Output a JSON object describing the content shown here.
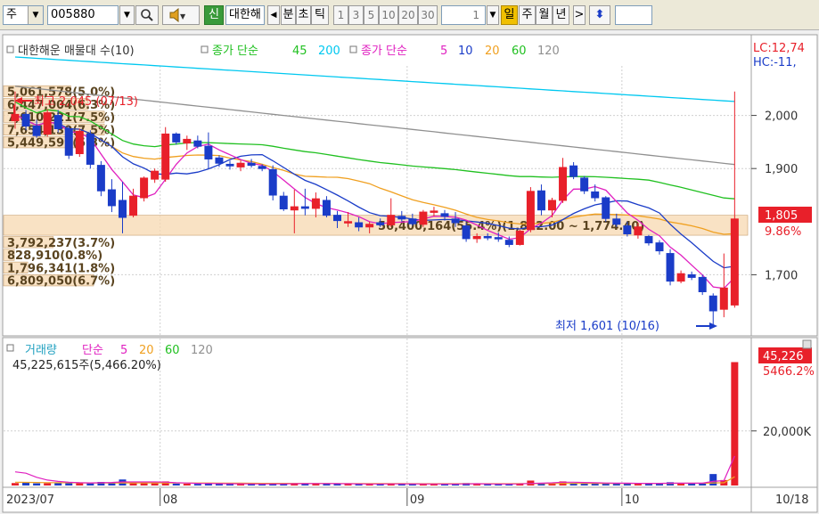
{
  "toolbar": {
    "market": "주",
    "code": "005880",
    "badge": "신",
    "name": "대한해",
    "periods": [
      "분",
      "초",
      "틱"
    ],
    "ticks": [
      "1",
      "3",
      "5",
      "10",
      "20",
      "30"
    ],
    "tick_input": "1",
    "day": "일",
    "week": "주",
    "month": "월",
    "year": "년"
  },
  "chart_data": {
    "type": "candlestick",
    "legend": {
      "vp": "대한해운 매물대 수(10)",
      "ma1_label": "종가 단순",
      "ma1_periods": [
        "45",
        "200"
      ],
      "ma2_label": "종가 단순",
      "ma2_periods": [
        "5",
        "10",
        "20",
        "60",
        "120"
      ]
    },
    "vol_legend": {
      "name": "거래량",
      "ma_label": "단순",
      "ma_periods": [
        "5",
        "20",
        "60",
        "120"
      ],
      "info": "45,225,615주(5,466.20%)"
    },
    "colors": {
      "up": "#e8202a",
      "down": "#1a3cc8",
      "ma5": "#e020c0",
      "ma10": "#1a3cc8",
      "ma20": "#f0a020",
      "ma60": "#20c020",
      "ma120": "#909090",
      "ma45": "#20c020",
      "ma200": "#00c8f0"
    },
    "corner": {
      "lc": "LC:12,74",
      "hc": "HC:-11,"
    },
    "price_ticks": [
      "2,000",
      "1,900",
      "1,700"
    ],
    "price_tick_values": [
      2000,
      1900,
      1700
    ],
    "price_range": [
      1590,
      2110
    ],
    "last_price": "1,805",
    "last_pct": "9.86%",
    "max_label": "최고 2,045 (07/13)",
    "min_label": "최저 1,601 (10/16)",
    "volume_profile": [
      {
        "label": "5,061,578(5.0%)",
        "price_low": 2035,
        "price_high": 2056
      },
      {
        "label": "6,447,004(6.3%)",
        "price_low": 2011,
        "price_high": 2032
      },
      {
        "label": "7,610,221(7.5%)",
        "price_low": 1987,
        "price_high": 2008
      },
      {
        "label": "7,654,130(7.5%)",
        "price_low": 1963,
        "price_high": 1984
      },
      {
        "label": "5,449,599(5.3%)",
        "price_low": 1939,
        "price_high": 1960
      },
      {
        "label": "56,400,164(55.4%)(1,812.00 ~ 1,774.40)",
        "price_low": 1774.4,
        "price_high": 1812
      },
      {
        "label": "3,792,237(3.7%)",
        "price_low": 1751,
        "price_high": 1772
      },
      {
        "label": "828,910(0.8%)",
        "price_low": 1727,
        "price_high": 1748
      },
      {
        "label": "1,796,341(1.8%)",
        "price_low": 1703,
        "price_high": 1724
      },
      {
        "label": "6,809,050(6.7%)",
        "price_low": 1679,
        "price_high": 1700
      }
    ],
    "volume_ticks": [
      "20,000K"
    ],
    "volume_tick_values": [
      20000
    ],
    "volume_range": [
      0,
      48000
    ],
    "volume_last": "45,226",
    "volume_last_pct": "5466.2%",
    "x_labels": [
      {
        "label": "2023/07",
        "index": 0
      },
      {
        "label": "08",
        "index": 14
      },
      {
        "label": "09",
        "index": 37
      },
      {
        "label": "10",
        "index": 57
      }
    ],
    "date_label": "10/18",
    "candles": [
      {
        "o": 1990,
        "h": 2045,
        "l": 1975,
        "c": 2002
      },
      {
        "o": 2002,
        "h": 2010,
        "l": 1972,
        "c": 1980
      },
      {
        "o": 1980,
        "h": 1992,
        "l": 1958,
        "c": 1962
      },
      {
        "o": 1965,
        "h": 2012,
        "l": 1960,
        "c": 2005
      },
      {
        "o": 2000,
        "h": 2010,
        "l": 1968,
        "c": 1975
      },
      {
        "o": 1975,
        "h": 1980,
        "l": 1918,
        "c": 1925
      },
      {
        "o": 1928,
        "h": 1975,
        "l": 1922,
        "c": 1970
      },
      {
        "o": 1965,
        "h": 1972,
        "l": 1900,
        "c": 1908
      },
      {
        "o": 1906,
        "h": 1914,
        "l": 1848,
        "c": 1858
      },
      {
        "o": 1860,
        "h": 1880,
        "l": 1818,
        "c": 1830
      },
      {
        "o": 1840,
        "h": 1875,
        "l": 1778,
        "c": 1808
      },
      {
        "o": 1812,
        "h": 1862,
        "l": 1808,
        "c": 1848
      },
      {
        "o": 1845,
        "h": 1885,
        "l": 1838,
        "c": 1882
      },
      {
        "o": 1880,
        "h": 1900,
        "l": 1873,
        "c": 1895
      },
      {
        "o": 1880,
        "h": 1978,
        "l": 1875,
        "c": 1965
      },
      {
        "o": 1965,
        "h": 1968,
        "l": 1945,
        "c": 1950
      },
      {
        "o": 1948,
        "h": 1962,
        "l": 1935,
        "c": 1955
      },
      {
        "o": 1952,
        "h": 1962,
        "l": 1938,
        "c": 1942
      },
      {
        "o": 1942,
        "h": 1968,
        "l": 1900,
        "c": 1918
      },
      {
        "o": 1920,
        "h": 1925,
        "l": 1903,
        "c": 1910
      },
      {
        "o": 1908,
        "h": 1915,
        "l": 1898,
        "c": 1905
      },
      {
        "o": 1903,
        "h": 1915,
        "l": 1895,
        "c": 1910
      },
      {
        "o": 1910,
        "h": 1918,
        "l": 1902,
        "c": 1906
      },
      {
        "o": 1904,
        "h": 1908,
        "l": 1895,
        "c": 1900
      },
      {
        "o": 1898,
        "h": 1906,
        "l": 1840,
        "c": 1850
      },
      {
        "o": 1848,
        "h": 1856,
        "l": 1820,
        "c": 1824
      },
      {
        "o": 1822,
        "h": 1860,
        "l": 1778,
        "c": 1828
      },
      {
        "o": 1828,
        "h": 1862,
        "l": 1812,
        "c": 1825
      },
      {
        "o": 1825,
        "h": 1855,
        "l": 1808,
        "c": 1843
      },
      {
        "o": 1840,
        "h": 1848,
        "l": 1808,
        "c": 1812
      },
      {
        "o": 1812,
        "h": 1820,
        "l": 1788,
        "c": 1802
      },
      {
        "o": 1800,
        "h": 1818,
        "l": 1790,
        "c": 1800
      },
      {
        "o": 1798,
        "h": 1808,
        "l": 1782,
        "c": 1790
      },
      {
        "o": 1790,
        "h": 1800,
        "l": 1778,
        "c": 1795
      },
      {
        "o": 1798,
        "h": 1806,
        "l": 1790,
        "c": 1794
      },
      {
        "o": 1794,
        "h": 1844,
        "l": 1790,
        "c": 1812
      },
      {
        "o": 1810,
        "h": 1820,
        "l": 1800,
        "c": 1805
      },
      {
        "o": 1805,
        "h": 1815,
        "l": 1792,
        "c": 1796
      },
      {
        "o": 1795,
        "h": 1822,
        "l": 1790,
        "c": 1818
      },
      {
        "o": 1818,
        "h": 1828,
        "l": 1810,
        "c": 1820
      },
      {
        "o": 1815,
        "h": 1822,
        "l": 1802,
        "c": 1810
      },
      {
        "o": 1805,
        "h": 1818,
        "l": 1790,
        "c": 1798
      },
      {
        "o": 1792,
        "h": 1798,
        "l": 1762,
        "c": 1768
      },
      {
        "o": 1768,
        "h": 1778,
        "l": 1760,
        "c": 1772
      },
      {
        "o": 1772,
        "h": 1778,
        "l": 1765,
        "c": 1770
      },
      {
        "o": 1770,
        "h": 1780,
        "l": 1762,
        "c": 1768
      },
      {
        "o": 1765,
        "h": 1772,
        "l": 1752,
        "c": 1757
      },
      {
        "o": 1757,
        "h": 1785,
        "l": 1755,
        "c": 1782
      },
      {
        "o": 1785,
        "h": 1865,
        "l": 1780,
        "c": 1857
      },
      {
        "o": 1858,
        "h": 1870,
        "l": 1812,
        "c": 1822
      },
      {
        "o": 1822,
        "h": 1845,
        "l": 1808,
        "c": 1840
      },
      {
        "o": 1840,
        "h": 1920,
        "l": 1835,
        "c": 1902
      },
      {
        "o": 1905,
        "h": 1912,
        "l": 1880,
        "c": 1885
      },
      {
        "o": 1882,
        "h": 1886,
        "l": 1852,
        "c": 1858
      },
      {
        "o": 1856,
        "h": 1870,
        "l": 1838,
        "c": 1845
      },
      {
        "o": 1845,
        "h": 1848,
        "l": 1800,
        "c": 1806
      },
      {
        "o": 1805,
        "h": 1815,
        "l": 1790,
        "c": 1795
      },
      {
        "o": 1792,
        "h": 1800,
        "l": 1772,
        "c": 1777
      },
      {
        "o": 1775,
        "h": 1798,
        "l": 1768,
        "c": 1790
      },
      {
        "o": 1772,
        "h": 1775,
        "l": 1755,
        "c": 1760
      },
      {
        "o": 1760,
        "h": 1765,
        "l": 1738,
        "c": 1745
      },
      {
        "o": 1740,
        "h": 1748,
        "l": 1680,
        "c": 1688
      },
      {
        "o": 1688,
        "h": 1708,
        "l": 1684,
        "c": 1702
      },
      {
        "o": 1700,
        "h": 1706,
        "l": 1690,
        "c": 1695
      },
      {
        "o": 1695,
        "h": 1700,
        "l": 1662,
        "c": 1668
      },
      {
        "o": 1660,
        "h": 1665,
        "l": 1601,
        "c": 1632
      },
      {
        "o": 1635,
        "h": 1740,
        "l": 1620,
        "c": 1675
      },
      {
        "o": 1643,
        "h": 2045,
        "l": 1638,
        "c": 1805
      }
    ],
    "volumes": [
      900,
      1000,
      800,
      850,
      900,
      900,
      950,
      800,
      1300,
      900,
      2200,
      1100,
      1000,
      800,
      1500,
      700,
      650,
      600,
      800,
      600,
      600,
      550,
      500,
      500,
      700,
      700,
      900,
      700,
      650,
      700,
      600,
      550,
      550,
      500,
      500,
      800,
      500,
      500,
      600,
      600,
      550,
      600,
      900,
      600,
      500,
      500,
      600,
      800,
      1800,
      900,
      800,
      1500,
      900,
      800,
      800,
      900,
      800,
      800,
      700,
      800,
      900,
      1200,
      700,
      700,
      800,
      4200,
      2000,
      45226
    ],
    "vol_ma5": [
      5000,
      4500,
      3000,
      2000,
      1500,
      1200,
      1000,
      950,
      1000,
      1100,
      1300,
      1300,
      1300,
      1300,
      1250,
      1000,
      900,
      800,
      750,
      700,
      650,
      620,
      580,
      560,
      580,
      600,
      650,
      700,
      720,
      720,
      700,
      650,
      600,
      570,
      550,
      600,
      600,
      580,
      560,
      560,
      570,
      560,
      600,
      640,
      600,
      560,
      560,
      580,
      760,
      860,
      980,
      1200,
      1200,
      1100,
      1000,
      920,
      860,
      840,
      800,
      800,
      800,
      850,
      860,
      860,
      860,
      1500,
      1800,
      10800
    ],
    "vol_ma20": [
      1200,
      1150,
      1100,
      1050,
      1000,
      1000,
      980,
      960,
      950,
      940,
      950,
      950,
      950,
      950,
      950,
      940,
      930,
      920,
      900,
      880,
      860,
      840,
      820,
      800,
      790,
      780,
      770,
      760,
      750,
      740,
      730,
      720,
      710,
      700,
      690,
      680,
      670,
      660,
      650,
      650,
      650,
      650,
      660,
      660,
      660,
      660,
      660,
      670,
      700,
      710,
      720,
      740,
      750,
      760,
      760,
      770,
      770,
      770,
      770,
      780,
      790,
      800,
      810,
      820,
      830,
      960,
      1020,
      3200
    ]
  }
}
